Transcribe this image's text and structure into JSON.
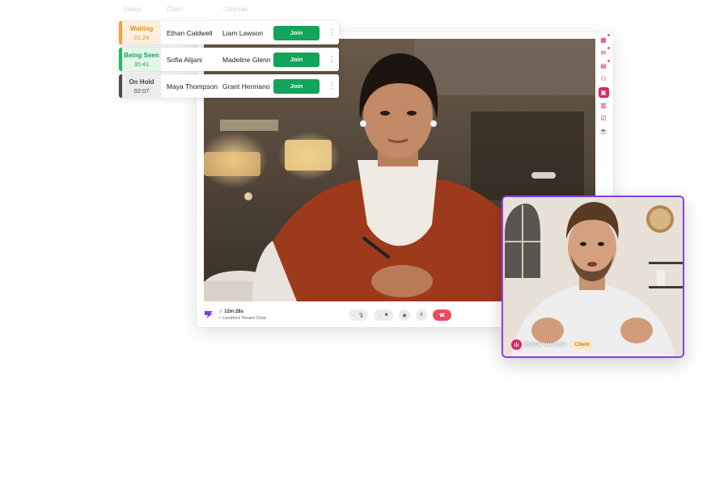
{
  "queue_header": {
    "status": "Status",
    "client": "Client",
    "clinician": "Clinician"
  },
  "queue": [
    {
      "status": "Waiting",
      "time": "01:24",
      "client": "Ethan Caldwell",
      "clinician": "Liam Lawson",
      "action": "Join",
      "status_color": "#f4a13a"
    },
    {
      "status": "Being Seen",
      "time": "35:41",
      "client": "Sofia Alijani",
      "clinician": "Madeline Glenn",
      "action": "Join",
      "status_color": "#22b865"
    },
    {
      "status": "On Hold",
      "time": "02:07",
      "client": "Maya Thompson",
      "clinician": "Grant Hermano",
      "action": "Join",
      "status_color": "#4a4a4a"
    }
  ],
  "call": {
    "duration": "12m 28s",
    "clinic": "Landford Tenant Clinic",
    "controls": [
      "microphone-icon",
      "camera-icon",
      "share-screen-icon",
      "raise-hand-icon",
      "end-call-icon"
    ]
  },
  "side_rail": {
    "icons": [
      "calendar-icon",
      "messages-icon",
      "notes-icon",
      "participants-icon",
      "video-call-icon",
      "documents-icon",
      "checklist-icon",
      "coffee-icon"
    ],
    "active": "video-call-icon"
  },
  "client_video": {
    "name": "Robbie Valentine",
    "role": "Client"
  },
  "colors": {
    "brand": "#e0245e",
    "join_button": "#13a35a",
    "end_call": "#ef4a5e",
    "pip_border": "#8b3fe0"
  }
}
